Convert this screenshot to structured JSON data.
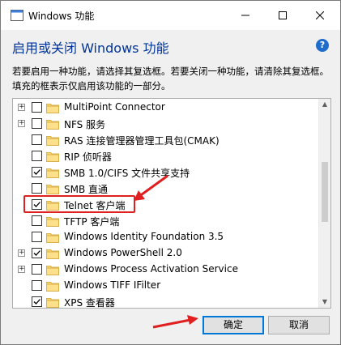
{
  "window": {
    "title": "Windows 功能",
    "minimize_glyph": "—",
    "maximize_glyph": "☐",
    "close_glyph": "✕"
  },
  "heading": "启用或关闭 Windows 功能",
  "help_glyph": "?",
  "description": "若要启用一种功能，请选择其复选框。若要关闭一种功能，请清除其复选框。填充的框表示仅启用该功能的一部分。",
  "features": [
    {
      "label": "MultiPoint Connector",
      "expandable": true,
      "checked": false
    },
    {
      "label": "NFS 服务",
      "expandable": true,
      "checked": false
    },
    {
      "label": "RAS 连接管理器管理工具包(CMAK)",
      "expandable": false,
      "checked": false
    },
    {
      "label": "RIP 侦听器",
      "expandable": false,
      "checked": false
    },
    {
      "label": "SMB 1.0/CIFS 文件共享支持",
      "expandable": false,
      "checked": true
    },
    {
      "label": "SMB 直通",
      "expandable": false,
      "checked": false
    },
    {
      "label": "Telnet 客户端",
      "expandable": false,
      "checked": true
    },
    {
      "label": "TFTP 客户端",
      "expandable": false,
      "checked": false
    },
    {
      "label": "Windows Identity Foundation 3.5",
      "expandable": false,
      "checked": false
    },
    {
      "label": "Windows PowerShell 2.0",
      "expandable": true,
      "checked": true
    },
    {
      "label": "Windows Process Activation Service",
      "expandable": true,
      "checked": false
    },
    {
      "label": "Windows TIFF IFilter",
      "expandable": false,
      "checked": false
    },
    {
      "label": "XPS 查看器",
      "expandable": false,
      "checked": true
    }
  ],
  "expander_glyph": "+",
  "buttons": {
    "ok": "确定",
    "cancel": "取消"
  },
  "colors": {
    "heading": "#003399",
    "highlight": "#e02020",
    "default_button_border": "#0078d7"
  }
}
